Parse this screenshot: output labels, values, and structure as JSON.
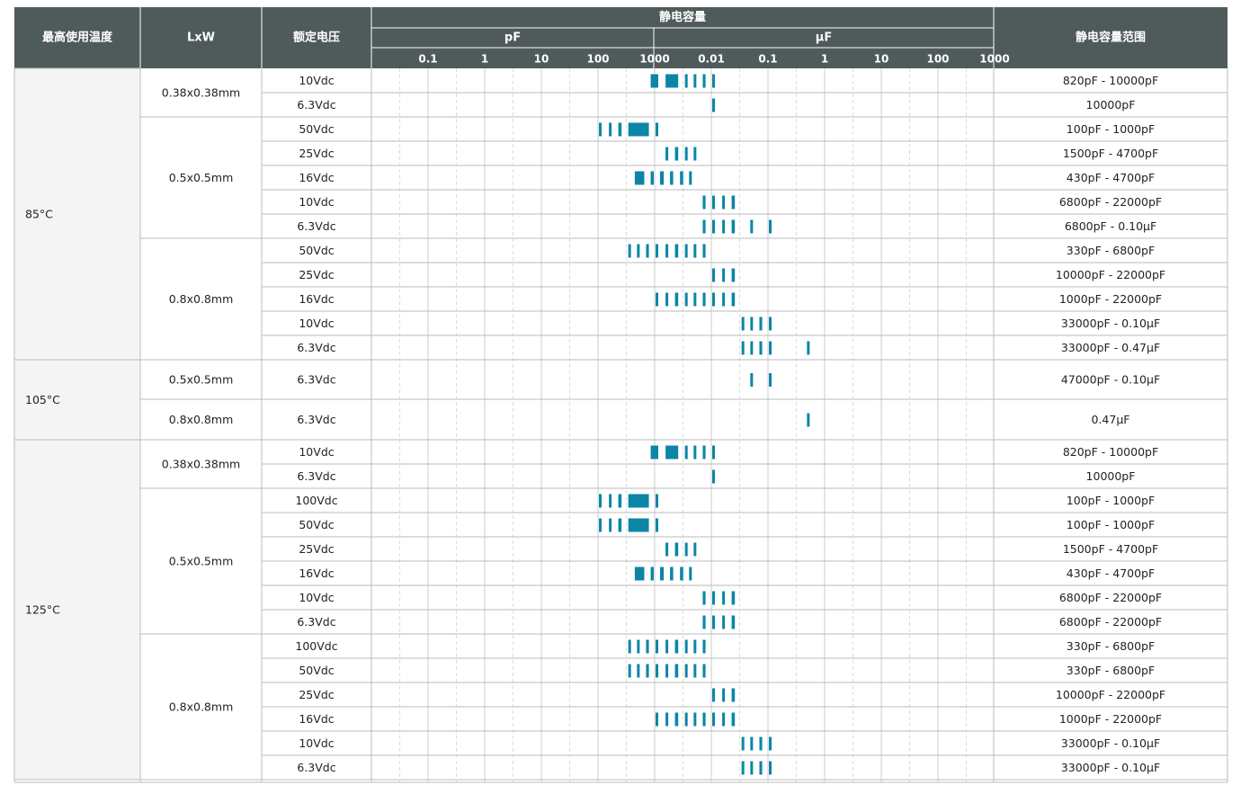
{
  "colors": {
    "header_bg": "#4f5a5b",
    "bar": "#0b86a6",
    "temp_bg": "#f4f4f4",
    "border": "#bbbbbb"
  },
  "headers": {
    "temp": "最高使用温度",
    "size": "LxW",
    "voltage": "额定电压",
    "capacitance": "静电容量",
    "pf_unit": "pF",
    "uf_unit": "μF",
    "range": "静电容量范围"
  },
  "chart_data": {
    "type": "table",
    "x_scale": "log",
    "x_ticks_pf": [
      "0.1",
      "1",
      "10",
      "100",
      "1000"
    ],
    "x_ticks_uf": [
      "0.01",
      "0.1",
      "1",
      "10",
      "100",
      "1000"
    ],
    "grid": true,
    "temp_groups": [
      {
        "temp": "85°C",
        "sizes": [
          {
            "size": "0.38x0.38mm",
            "rows": [
              {
                "voltage": "10Vdc",
                "range": "820pF - 10000pF"
              },
              {
                "voltage": "6.3Vdc",
                "range": "10000pF"
              }
            ]
          },
          {
            "size": "0.5x0.5mm",
            "rows": [
              {
                "voltage": "50Vdc",
                "range": "100pF - 1000pF"
              },
              {
                "voltage": "25Vdc",
                "range": "1500pF - 4700pF"
              },
              {
                "voltage": "16Vdc",
                "range": "430pF - 4700pF"
              },
              {
                "voltage": "10Vdc",
                "range": "6800pF - 22000pF"
              },
              {
                "voltage": "6.3Vdc",
                "range": "6800pF - 0.10μF"
              }
            ]
          },
          {
            "size": "0.8x0.8mm",
            "rows": [
              {
                "voltage": "50Vdc",
                "range": "330pF - 6800pF"
              },
              {
                "voltage": "25Vdc",
                "range": "10000pF - 22000pF"
              },
              {
                "voltage": "16Vdc",
                "range": "1000pF - 22000pF"
              },
              {
                "voltage": "10Vdc",
                "range": "33000pF - 0.10μF"
              },
              {
                "voltage": "6.3Vdc",
                "range": "33000pF - 0.47μF"
              }
            ]
          }
        ]
      },
      {
        "temp": "105°C",
        "sizes": [
          {
            "size": "0.5x0.5mm",
            "rows": [
              {
                "voltage": "6.3Vdc",
                "range": "47000pF - 0.10μF"
              }
            ]
          },
          {
            "size": "0.8x0.8mm",
            "rows": [
              {
                "voltage": "6.3Vdc",
                "range": "0.47μF"
              }
            ]
          }
        ]
      },
      {
        "temp": "125°C",
        "sizes": [
          {
            "size": "0.38x0.38mm",
            "rows": [
              {
                "voltage": "10Vdc",
                "range": "820pF - 10000pF"
              },
              {
                "voltage": "6.3Vdc",
                "range": "10000pF"
              }
            ]
          },
          {
            "size": "0.5x0.5mm",
            "rows": [
              {
                "voltage": "100Vdc",
                "range": "100pF - 1000pF"
              },
              {
                "voltage": "50Vdc",
                "range": "100pF - 1000pF"
              },
              {
                "voltage": "25Vdc",
                "range": "1500pF - 4700pF"
              },
              {
                "voltage": "16Vdc",
                "range": "430pF - 4700pF"
              },
              {
                "voltage": "10Vdc",
                "range": "6800pF - 22000pF"
              },
              {
                "voltage": "6.3Vdc",
                "range": "6800pF - 22000pF"
              }
            ]
          },
          {
            "size": "0.8x0.8mm",
            "rows": [
              {
                "voltage": "100Vdc",
                "range": "330pF - 6800pF"
              },
              {
                "voltage": "50Vdc",
                "range": "330pF - 6800pF"
              },
              {
                "voltage": "25Vdc",
                "range": "10000pF - 22000pF"
              },
              {
                "voltage": "16Vdc",
                "range": "1000pF - 22000pF"
              },
              {
                "voltage": "10Vdc",
                "range": "33000pF - 0.10μF"
              },
              {
                "voltage": "6.3Vdc",
                "range": "33000pF - 0.10μF"
              }
            ]
          }
        ]
      }
    ]
  }
}
